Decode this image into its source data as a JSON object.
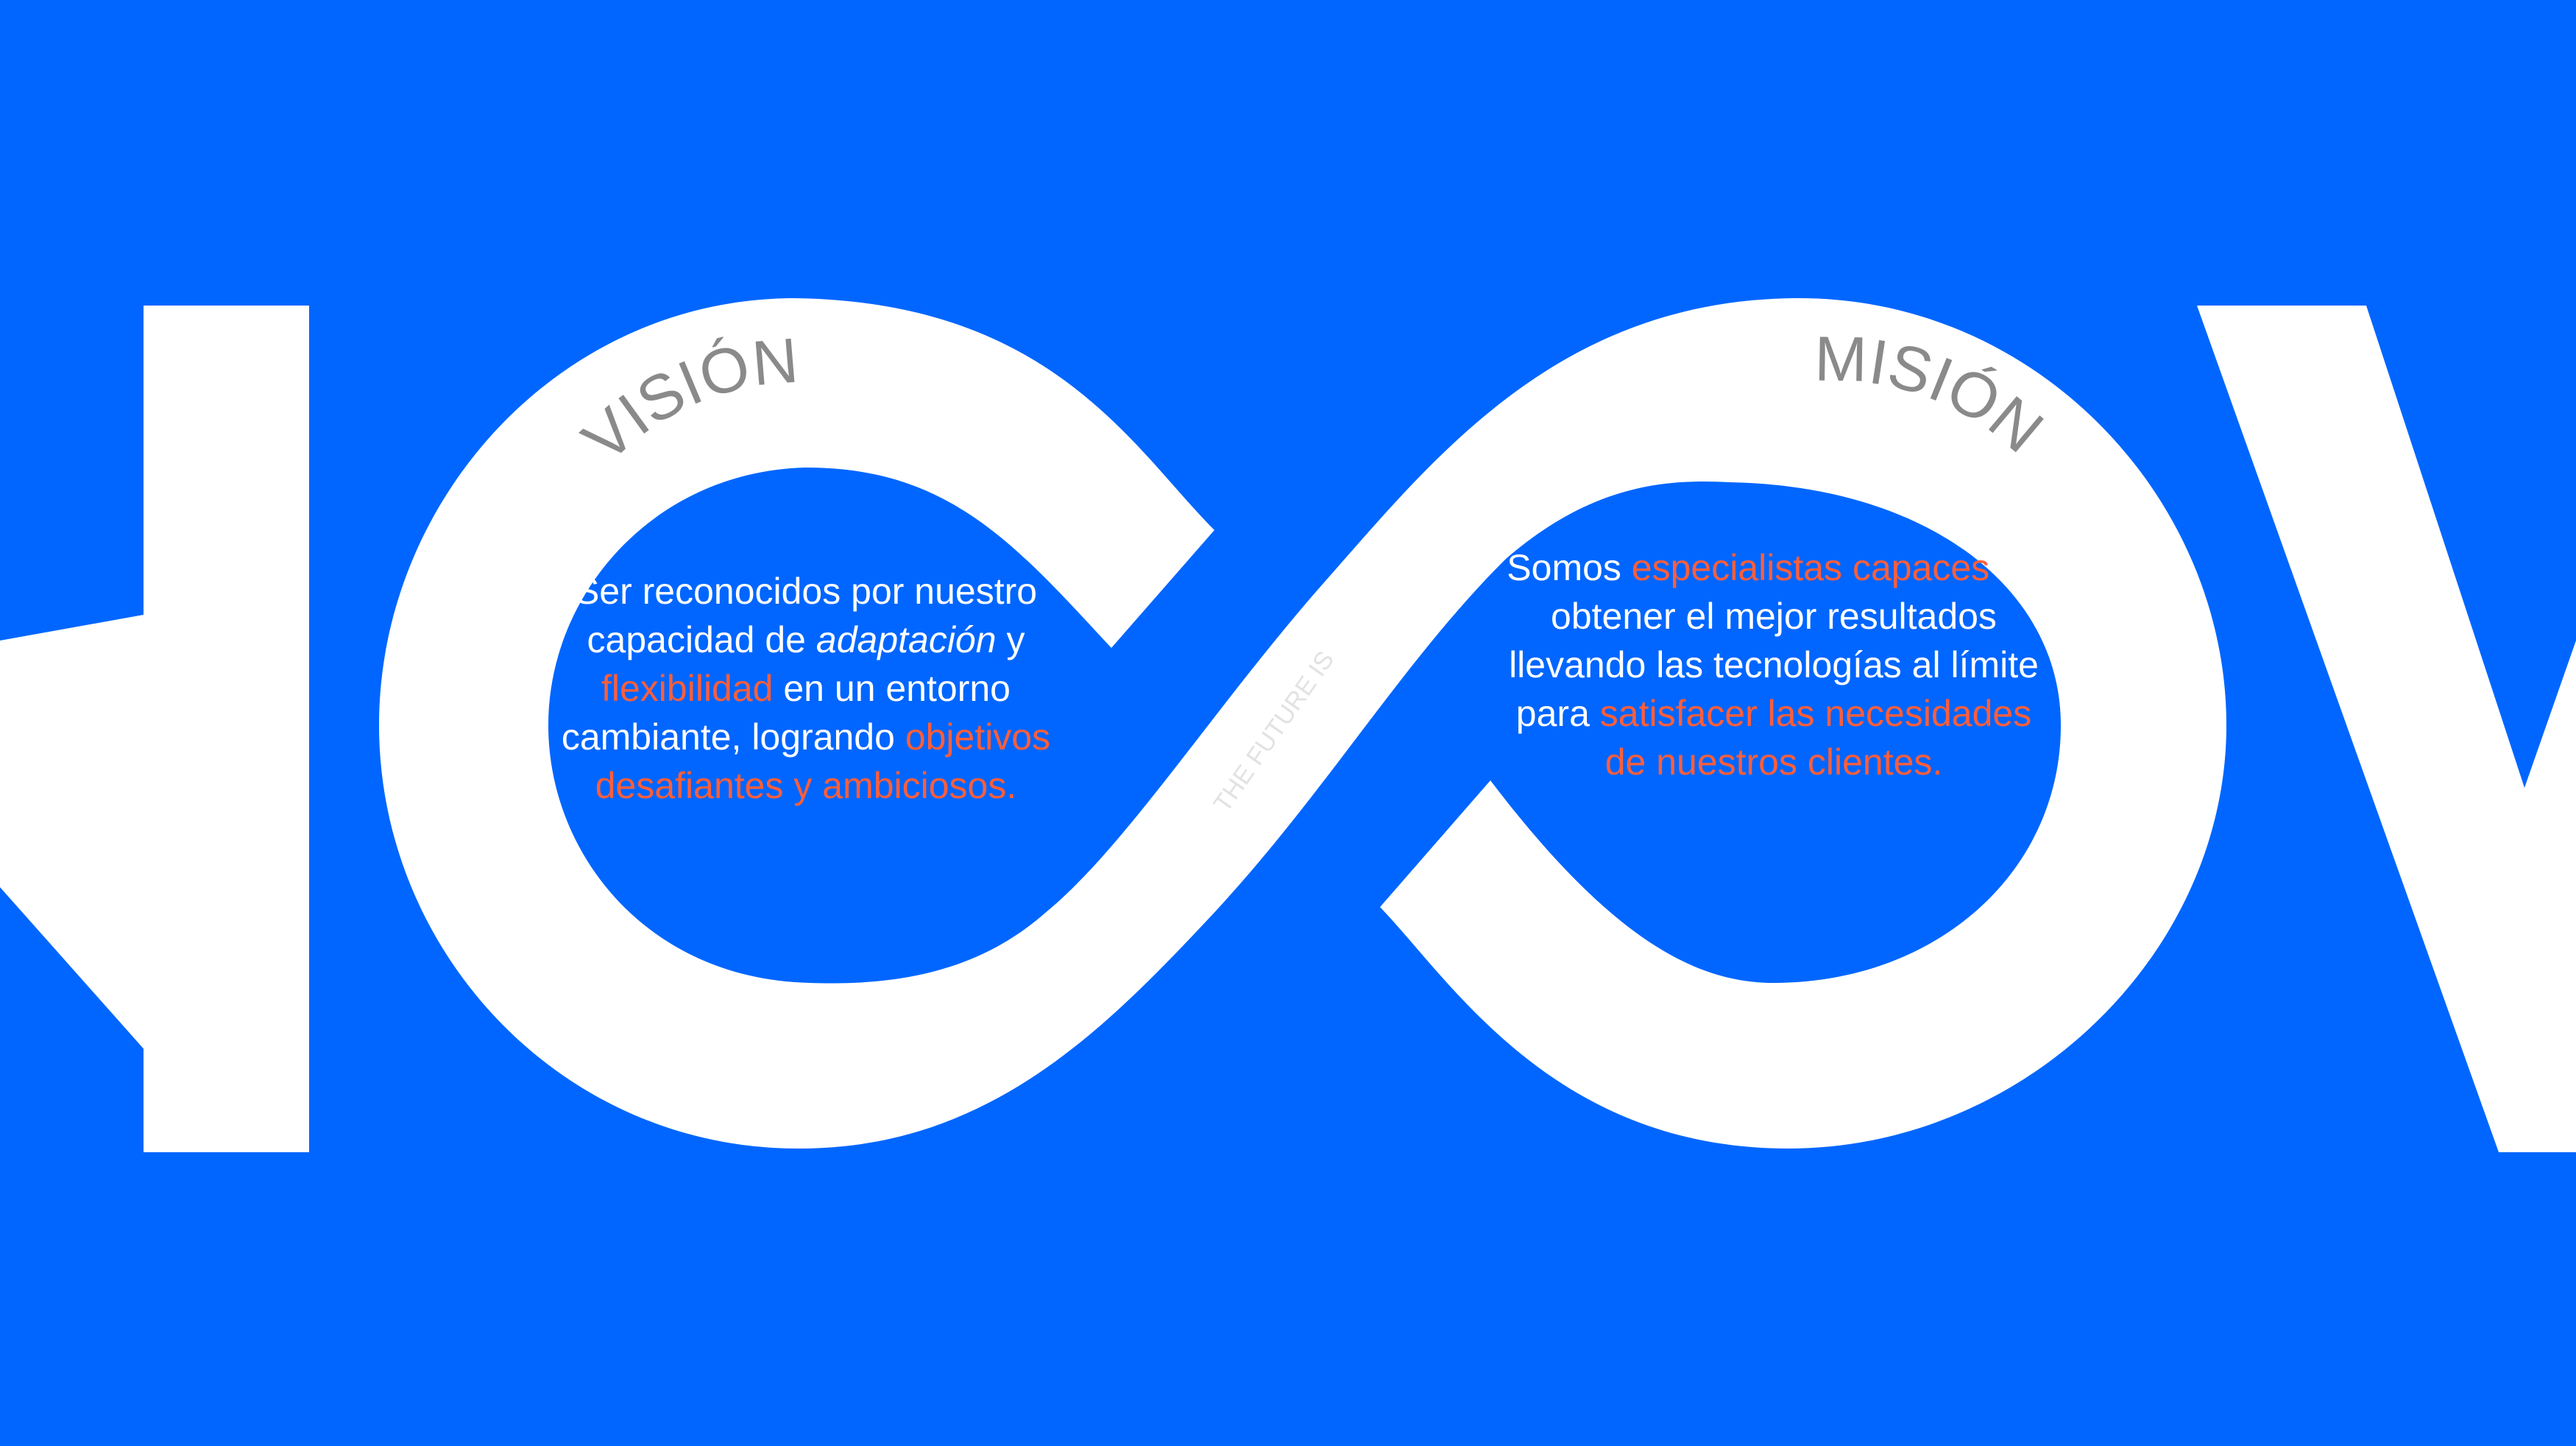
{
  "colors": {
    "background": "#0066FF",
    "shape": "#FFFFFF",
    "highlight": "#FF5E3A",
    "arc_label": "#8A8A8A"
  },
  "logo": {
    "tagline": "THE FUTURE IS"
  },
  "vision": {
    "label": "VISIÓN",
    "text": {
      "p1": "Ser reconocidos por nuestro capacidad de ",
      "em": "adaptación",
      "p2": " y ",
      "h1": "flexibilidad",
      "p3": " en un entorno cambiante, logrando ",
      "h2": "objetivos desafiantes y ambiciosos."
    }
  },
  "mission": {
    "label": "MISIÓN",
    "text": {
      "p1": "Somos ",
      "h1": "especialistas capaces",
      "p2": " de obtener el mejor resultados llevando las tecnologías al límite para ",
      "h2": "satisfacer las necesidades de nuestros clientes."
    }
  }
}
